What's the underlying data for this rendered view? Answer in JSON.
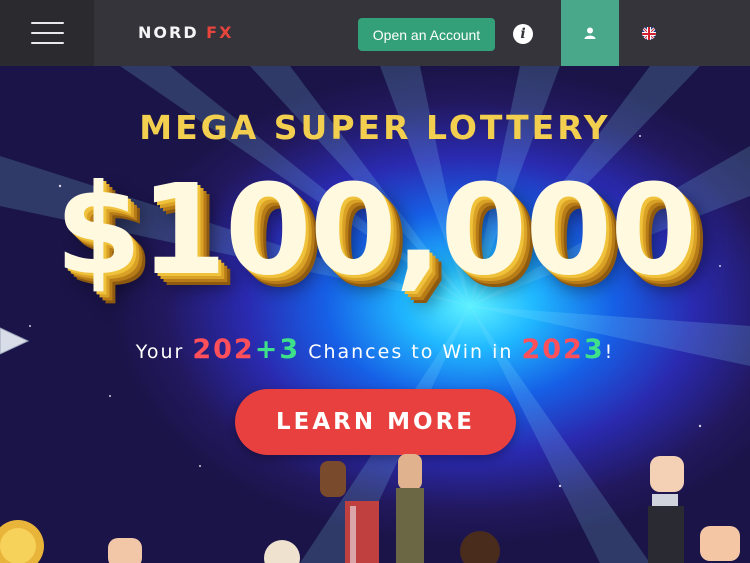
{
  "header": {
    "logo_left": "NORD",
    "logo_right": "FX",
    "open_account_label": "Open an Account",
    "info_icon": "i"
  },
  "hero": {
    "headline": "MEGA SUPER LOTTERY",
    "amount": "$100,000",
    "tagline_prefix": "Your",
    "tagline_num1": "202",
    "tagline_plus": "+3",
    "tagline_mid": "Chances to Win in",
    "tagline_year_a": "202",
    "tagline_year_b": "3",
    "tagline_end": "!",
    "cta_label": "LEARN MORE"
  },
  "colors": {
    "topbar": "#34343a",
    "accent_green": "#33a07a",
    "cta_red": "#e8403e",
    "gold": "#f2cf4e"
  },
  "icons": [
    "menu-icon",
    "info-icon",
    "user-icon",
    "uk-flag-icon"
  ]
}
